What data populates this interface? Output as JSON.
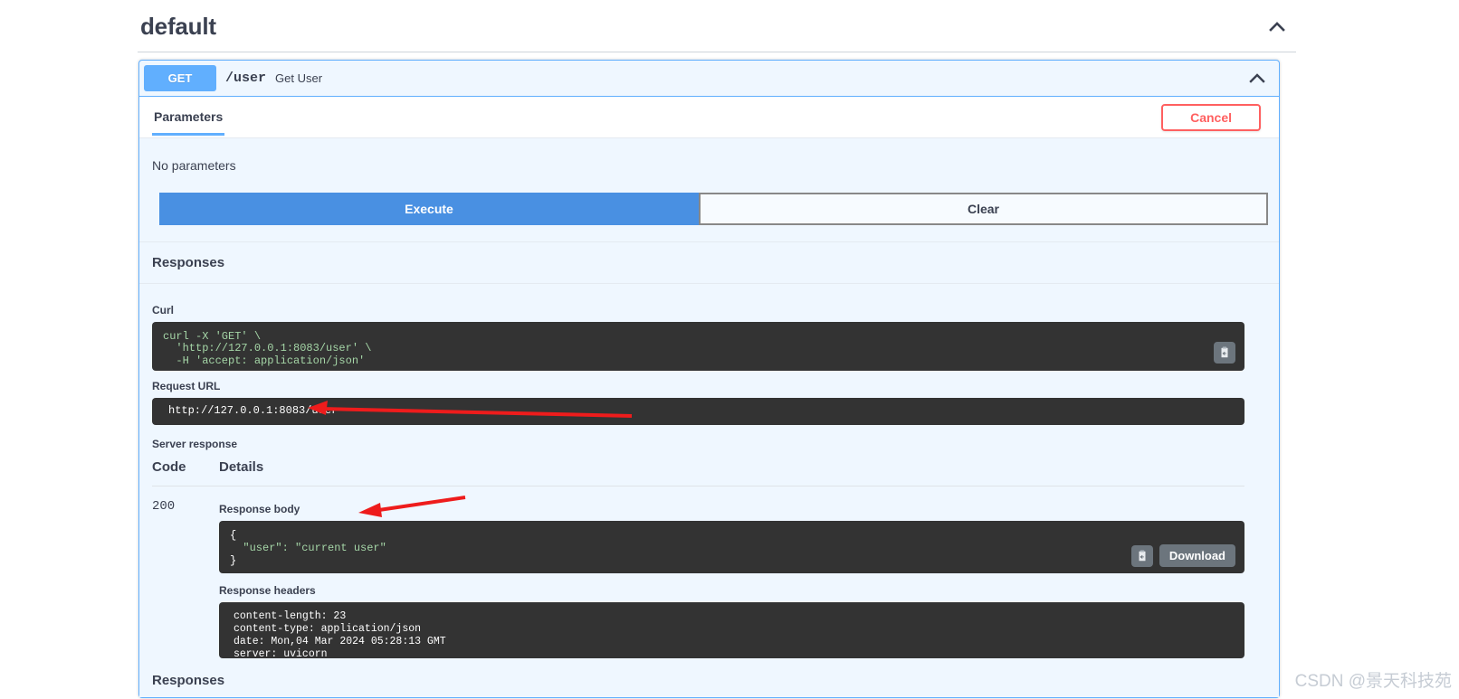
{
  "tag": {
    "title": "default",
    "collapse_icon": "chevron-up-icon"
  },
  "operation": {
    "method": "GET",
    "path": "/user",
    "summary": "Get User",
    "collapse_icon": "chevron-up-icon"
  },
  "tabs": {
    "parameters_label": "Parameters",
    "cancel_label": "Cancel"
  },
  "parameters": {
    "empty_text": "No parameters"
  },
  "actions": {
    "execute_label": "Execute",
    "clear_label": "Clear"
  },
  "responses_section": {
    "heading": "Responses",
    "bottom_heading": "Responses"
  },
  "curl": {
    "label": "Curl",
    "line1": "curl -X 'GET' \\",
    "line2": "  'http://127.0.0.1:8083/user' \\",
    "line3": "  -H 'accept: application/json'",
    "copy_icon": "copy-to-clipboard-icon"
  },
  "request_url": {
    "label": "Request URL",
    "value": "http://127.0.0.1:8083/user"
  },
  "server_response": {
    "label": "Server response",
    "columns": {
      "code": "Code",
      "details": "Details"
    },
    "rows": [
      {
        "code": "200",
        "response_body_label": "Response body",
        "response_body_open": "{",
        "response_body_line": "  \"user\": \"current user\"",
        "response_body_close": "}",
        "download_label": "Download",
        "copy_icon": "copy-to-clipboard-icon",
        "response_headers_label": "Response headers",
        "response_headers": [
          "content-length: 23",
          "content-type: application/json",
          "date: Mon,04 Mar 2024 05:28:13 GMT",
          "server: uvicorn"
        ]
      }
    ]
  },
  "watermark": {
    "text": "CSDN @景天科技苑"
  },
  "colors": {
    "method_get": "#61affe",
    "execute_blue": "#4990e2",
    "cancel_red": "#ff6060",
    "code_bg": "#333333",
    "code_green": "#a5d6a7",
    "panel_bg": "#eff7ff",
    "annotation_red": "#ee1c1c"
  }
}
